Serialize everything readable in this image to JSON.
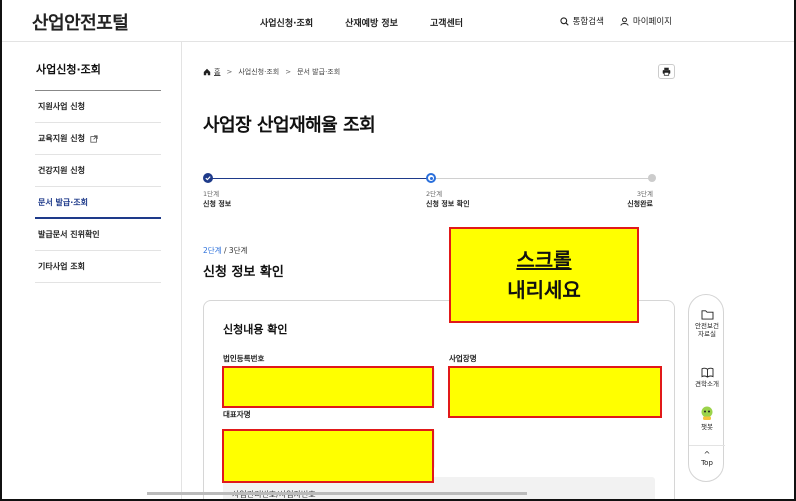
{
  "header": {
    "logo": "산업안전포털",
    "nav": [
      "사업신청·조회",
      "산재예방 정보",
      "고객센터"
    ],
    "search_label": "통합검색",
    "mypage_label": "마이페이지"
  },
  "sidebar": {
    "title": "사업신청·조회",
    "items": [
      {
        "label": "지원사업 신청"
      },
      {
        "label": "교육지원 신청"
      },
      {
        "label": "건강지원 신청"
      },
      {
        "label": "문서 발급·조회"
      },
      {
        "label": "발급문서 진위확인"
      },
      {
        "label": "기타사업 조회"
      }
    ],
    "active_index": 3
  },
  "breadcrumb": {
    "home": "홈",
    "items": [
      "사업신청·조회",
      "문서 발급·조회"
    ]
  },
  "page_title": "사업장 산업재해율 조회",
  "stepper": {
    "steps": [
      {
        "num": "1단계",
        "name": "신청 정보"
      },
      {
        "num": "2단계",
        "name": "신청 정보 확인"
      },
      {
        "num": "3단계",
        "name": "신청완료"
      }
    ]
  },
  "section": {
    "step_current": "2단계",
    "step_total": " / 3단계",
    "title": "신청 정보 확인"
  },
  "card": {
    "title": "신청내용 확인",
    "field1_label": "법인등록번호",
    "field2_label": "사업장명",
    "field3_label": "대표자명",
    "cut_text": "사업관리번호/사업자번호"
  },
  "quick_menu": {
    "items": [
      {
        "label": "안전보건\n자료실",
        "icon": "folder-icon"
      },
      {
        "label": "견학소개",
        "icon": "book-icon"
      },
      {
        "label": "챗봇",
        "icon": "chatbot-icon"
      }
    ],
    "top_label": "Top"
  },
  "callout": {
    "line1": "스크롤",
    "line2": "내리세요"
  },
  "colors": {
    "accent": "#1e3a8a",
    "step_active": "#2a6fdb",
    "redact_fill": "#ffff00",
    "redact_border": "#e11919"
  }
}
